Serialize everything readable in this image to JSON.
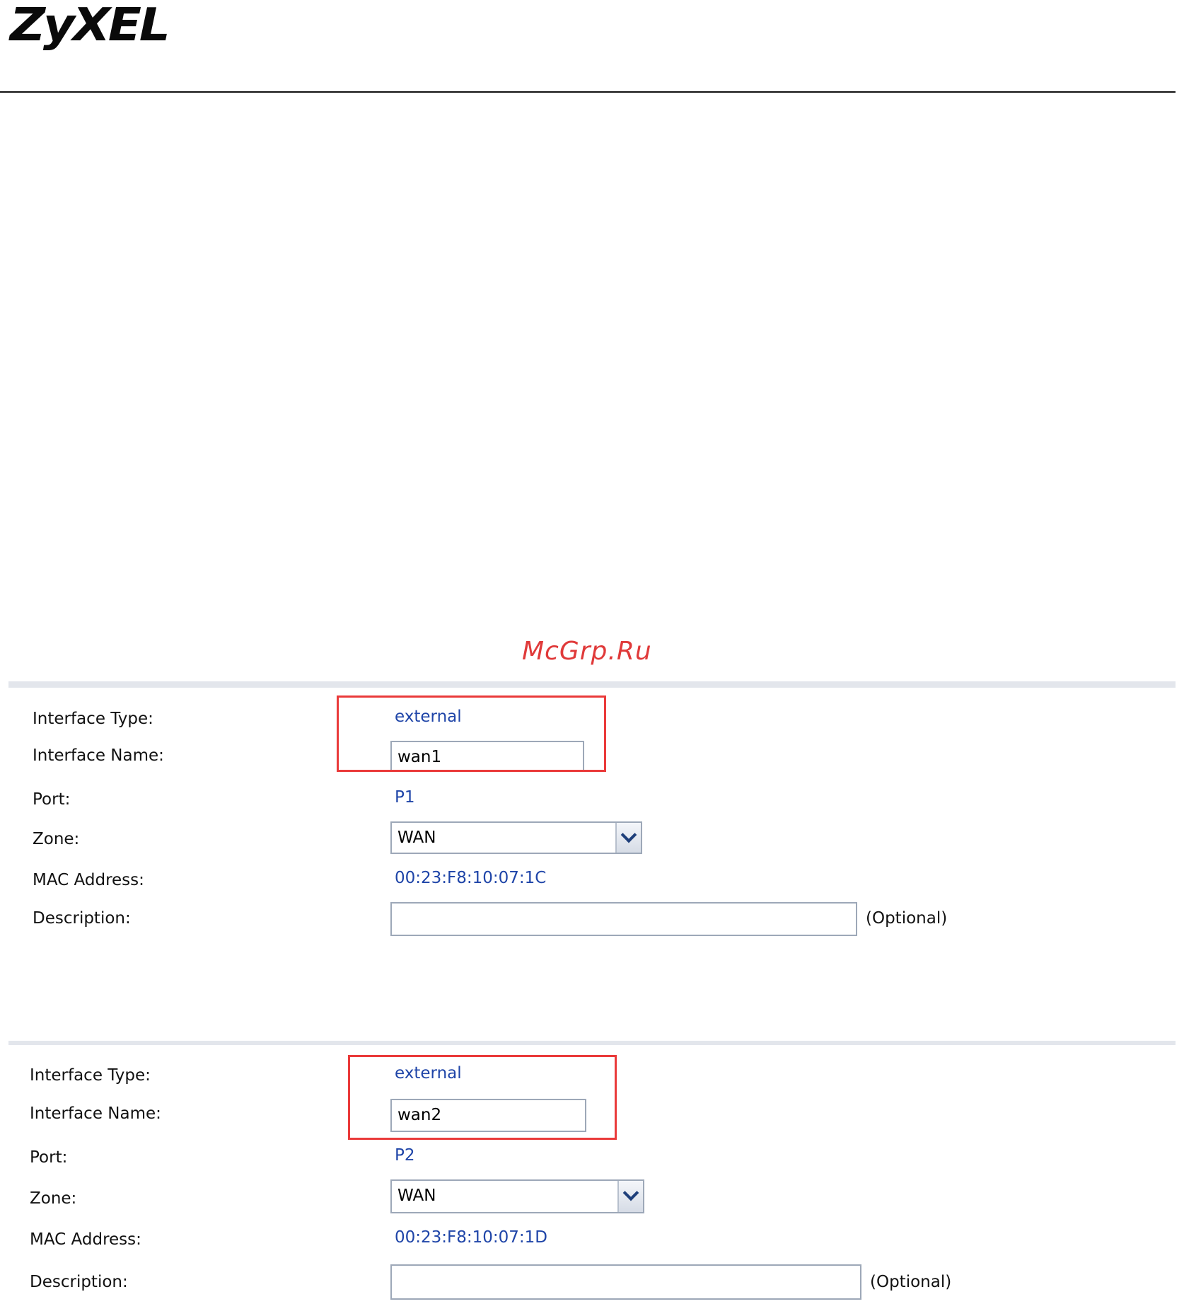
{
  "header": {
    "brand": "ZyXEL"
  },
  "watermark": "McGrp.Ru",
  "panels": [
    {
      "interface_type_label": "Interface Type:",
      "interface_type_value": "external",
      "interface_name_label": "Interface Name:",
      "interface_name_value": "wan1",
      "port_label": "Port:",
      "port_value": "P1",
      "zone_label": "Zone:",
      "zone_value": "WAN",
      "mac_label": "MAC Address:",
      "mac_value": "00:23:F8:10:07:1C",
      "description_label": "Description:",
      "description_value": "",
      "optional_text": "(Optional)"
    },
    {
      "interface_type_label": "Interface Type:",
      "interface_type_value": "external",
      "interface_name_label": "Interface Name:",
      "interface_name_value": "wan2",
      "port_label": "Port:",
      "port_value": "P2",
      "zone_label": "Zone:",
      "zone_value": "WAN",
      "mac_label": "MAC Address:",
      "mac_value": "00:23:F8:10:07:1D",
      "description_label": "Description:",
      "description_value": "",
      "optional_text": "(Optional)"
    }
  ],
  "colors": {
    "highlight": "#ea3a3a",
    "value_text": "#1f45a8",
    "panel_rule": "#e3e6ec"
  }
}
